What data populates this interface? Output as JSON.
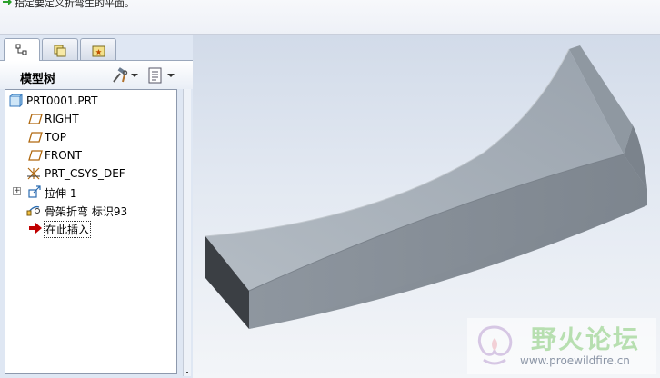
{
  "message": {
    "text": "指定要定义折弯生的平面。",
    "icon": "green-arrow-icon"
  },
  "tabs": [
    {
      "name": "model-tree-tab",
      "icon": "tree-icon",
      "active": true
    },
    {
      "name": "layers-tab",
      "icon": "layers-icon",
      "active": false
    },
    {
      "name": "favorites-tab",
      "icon": "folder-star-icon",
      "active": false
    }
  ],
  "tree_header": {
    "title": "模型树",
    "settings_icon": "tools-icon",
    "show_icon": "list-icon"
  },
  "tree": {
    "items": [
      {
        "label": "PRT0001.PRT",
        "icon": "part-icon"
      },
      {
        "label": "RIGHT",
        "icon": "datum-plane-icon"
      },
      {
        "label": "TOP",
        "icon": "datum-plane-icon"
      },
      {
        "label": "FRONT",
        "icon": "datum-plane-icon"
      },
      {
        "label": "PRT_CSYS_DEF",
        "icon": "csys-icon"
      },
      {
        "label": "拉伸 1",
        "icon": "extrude-icon",
        "expandable": true
      },
      {
        "label": "骨架折弯 标识93",
        "icon": "spinal-bend-icon"
      },
      {
        "label": "在此插入",
        "icon": "insert-here-arrow-icon",
        "selected": true
      }
    ]
  },
  "colors": {
    "panel_bg": "#dfe7f3",
    "viewport_top": "#d2dbe9",
    "viewport_bottom": "#f3f5f8",
    "part_top_face": "#a9b2bb",
    "part_front_face": "#8d959e",
    "part_end_face": "#3b3f44",
    "insert_arrow": "#c00000"
  },
  "watermark": {
    "title": "野火论坛",
    "url": "www.proewildfire.cn"
  }
}
